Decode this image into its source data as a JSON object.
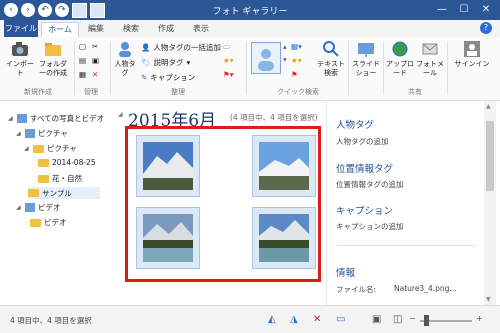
{
  "window": {
    "title": "フォト ギャラリー"
  },
  "tabs": [
    {
      "label": "ファイル"
    },
    {
      "label": "ホーム"
    },
    {
      "label": "編集"
    },
    {
      "label": "検索"
    },
    {
      "label": "作成"
    },
    {
      "label": "表示"
    }
  ],
  "ribbon": {
    "import_label": "インポート",
    "new_folder_label": "フォルダーの作成",
    "group_new": "新規作成",
    "group_manage": "管理",
    "people_tag_label": "人物タグ",
    "bulk_people_tag": "人物タグの一括追加",
    "caption_tag": "説明タグ",
    "caption": "キャプション",
    "group_organize": "整理",
    "text_search": "テキスト検索",
    "group_quick_search": "クイック検索",
    "slideshow": "スライドショー",
    "upload": "アップロード",
    "photo_mail": "フォトメール",
    "group_share": "共有",
    "sign_in": "サインイン"
  },
  "nav": {
    "items": [
      {
        "label": "すべての写真とビデオ"
      },
      {
        "label": "ピクチャ"
      },
      {
        "label": "ピクチャ"
      },
      {
        "label": "2014-08-25"
      },
      {
        "label": "花・自然"
      },
      {
        "label": "サンプル"
      },
      {
        "label": "ビデオ"
      },
      {
        "label": "ビデオ"
      }
    ]
  },
  "main": {
    "heading": "2015年6月",
    "count": "(4 項目中、4 項目を選択)"
  },
  "details": {
    "people_heading": "人物タグ",
    "people_add": "人物タグの追加",
    "geo_heading": "位置情報タグ",
    "geo_add": "位置情報タグの追加",
    "caption_heading": "キャプション",
    "caption_add": "キャプションの追加",
    "info_heading": "情報",
    "filename_label": "ファイル名:",
    "filename_value": "Nature3_4.png..."
  },
  "status": {
    "text": "4 項目中、4 項目を選択"
  },
  "colors": {
    "title_bar": "#2b5797",
    "accent": "#2b579a",
    "highlight": "#e01b1b"
  }
}
